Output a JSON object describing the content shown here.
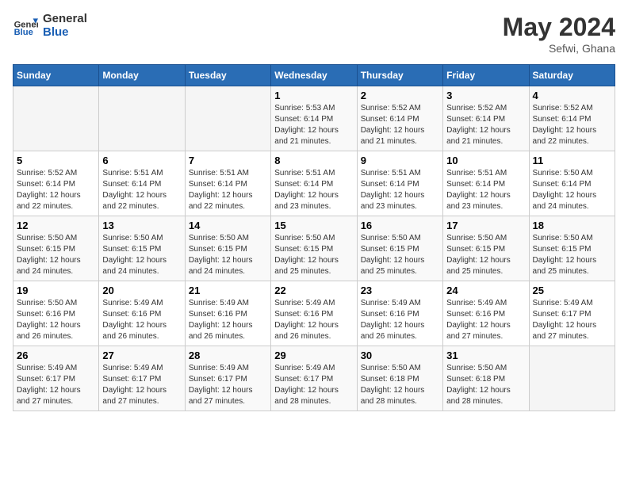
{
  "header": {
    "logo_text_general": "General",
    "logo_text_blue": "Blue",
    "month_year": "May 2024",
    "location": "Sefwi, Ghana"
  },
  "days_of_week": [
    "Sunday",
    "Monday",
    "Tuesday",
    "Wednesday",
    "Thursday",
    "Friday",
    "Saturday"
  ],
  "weeks": [
    [
      {
        "day": "",
        "info": ""
      },
      {
        "day": "",
        "info": ""
      },
      {
        "day": "",
        "info": ""
      },
      {
        "day": "1",
        "info": "Sunrise: 5:53 AM\nSunset: 6:14 PM\nDaylight: 12 hours and 21 minutes."
      },
      {
        "day": "2",
        "info": "Sunrise: 5:52 AM\nSunset: 6:14 PM\nDaylight: 12 hours and 21 minutes."
      },
      {
        "day": "3",
        "info": "Sunrise: 5:52 AM\nSunset: 6:14 PM\nDaylight: 12 hours and 21 minutes."
      },
      {
        "day": "4",
        "info": "Sunrise: 5:52 AM\nSunset: 6:14 PM\nDaylight: 12 hours and 22 minutes."
      }
    ],
    [
      {
        "day": "5",
        "info": "Sunrise: 5:52 AM\nSunset: 6:14 PM\nDaylight: 12 hours and 22 minutes."
      },
      {
        "day": "6",
        "info": "Sunrise: 5:51 AM\nSunset: 6:14 PM\nDaylight: 12 hours and 22 minutes."
      },
      {
        "day": "7",
        "info": "Sunrise: 5:51 AM\nSunset: 6:14 PM\nDaylight: 12 hours and 22 minutes."
      },
      {
        "day": "8",
        "info": "Sunrise: 5:51 AM\nSunset: 6:14 PM\nDaylight: 12 hours and 23 minutes."
      },
      {
        "day": "9",
        "info": "Sunrise: 5:51 AM\nSunset: 6:14 PM\nDaylight: 12 hours and 23 minutes."
      },
      {
        "day": "10",
        "info": "Sunrise: 5:51 AM\nSunset: 6:14 PM\nDaylight: 12 hours and 23 minutes."
      },
      {
        "day": "11",
        "info": "Sunrise: 5:50 AM\nSunset: 6:14 PM\nDaylight: 12 hours and 24 minutes."
      }
    ],
    [
      {
        "day": "12",
        "info": "Sunrise: 5:50 AM\nSunset: 6:15 PM\nDaylight: 12 hours and 24 minutes."
      },
      {
        "day": "13",
        "info": "Sunrise: 5:50 AM\nSunset: 6:15 PM\nDaylight: 12 hours and 24 minutes."
      },
      {
        "day": "14",
        "info": "Sunrise: 5:50 AM\nSunset: 6:15 PM\nDaylight: 12 hours and 24 minutes."
      },
      {
        "day": "15",
        "info": "Sunrise: 5:50 AM\nSunset: 6:15 PM\nDaylight: 12 hours and 25 minutes."
      },
      {
        "day": "16",
        "info": "Sunrise: 5:50 AM\nSunset: 6:15 PM\nDaylight: 12 hours and 25 minutes."
      },
      {
        "day": "17",
        "info": "Sunrise: 5:50 AM\nSunset: 6:15 PM\nDaylight: 12 hours and 25 minutes."
      },
      {
        "day": "18",
        "info": "Sunrise: 5:50 AM\nSunset: 6:15 PM\nDaylight: 12 hours and 25 minutes."
      }
    ],
    [
      {
        "day": "19",
        "info": "Sunrise: 5:50 AM\nSunset: 6:16 PM\nDaylight: 12 hours and 26 minutes."
      },
      {
        "day": "20",
        "info": "Sunrise: 5:49 AM\nSunset: 6:16 PM\nDaylight: 12 hours and 26 minutes."
      },
      {
        "day": "21",
        "info": "Sunrise: 5:49 AM\nSunset: 6:16 PM\nDaylight: 12 hours and 26 minutes."
      },
      {
        "day": "22",
        "info": "Sunrise: 5:49 AM\nSunset: 6:16 PM\nDaylight: 12 hours and 26 minutes."
      },
      {
        "day": "23",
        "info": "Sunrise: 5:49 AM\nSunset: 6:16 PM\nDaylight: 12 hours and 26 minutes."
      },
      {
        "day": "24",
        "info": "Sunrise: 5:49 AM\nSunset: 6:16 PM\nDaylight: 12 hours and 27 minutes."
      },
      {
        "day": "25",
        "info": "Sunrise: 5:49 AM\nSunset: 6:17 PM\nDaylight: 12 hours and 27 minutes."
      }
    ],
    [
      {
        "day": "26",
        "info": "Sunrise: 5:49 AM\nSunset: 6:17 PM\nDaylight: 12 hours and 27 minutes."
      },
      {
        "day": "27",
        "info": "Sunrise: 5:49 AM\nSunset: 6:17 PM\nDaylight: 12 hours and 27 minutes."
      },
      {
        "day": "28",
        "info": "Sunrise: 5:49 AM\nSunset: 6:17 PM\nDaylight: 12 hours and 27 minutes."
      },
      {
        "day": "29",
        "info": "Sunrise: 5:49 AM\nSunset: 6:17 PM\nDaylight: 12 hours and 28 minutes."
      },
      {
        "day": "30",
        "info": "Sunrise: 5:50 AM\nSunset: 6:18 PM\nDaylight: 12 hours and 28 minutes."
      },
      {
        "day": "31",
        "info": "Sunrise: 5:50 AM\nSunset: 6:18 PM\nDaylight: 12 hours and 28 minutes."
      },
      {
        "day": "",
        "info": ""
      }
    ]
  ]
}
